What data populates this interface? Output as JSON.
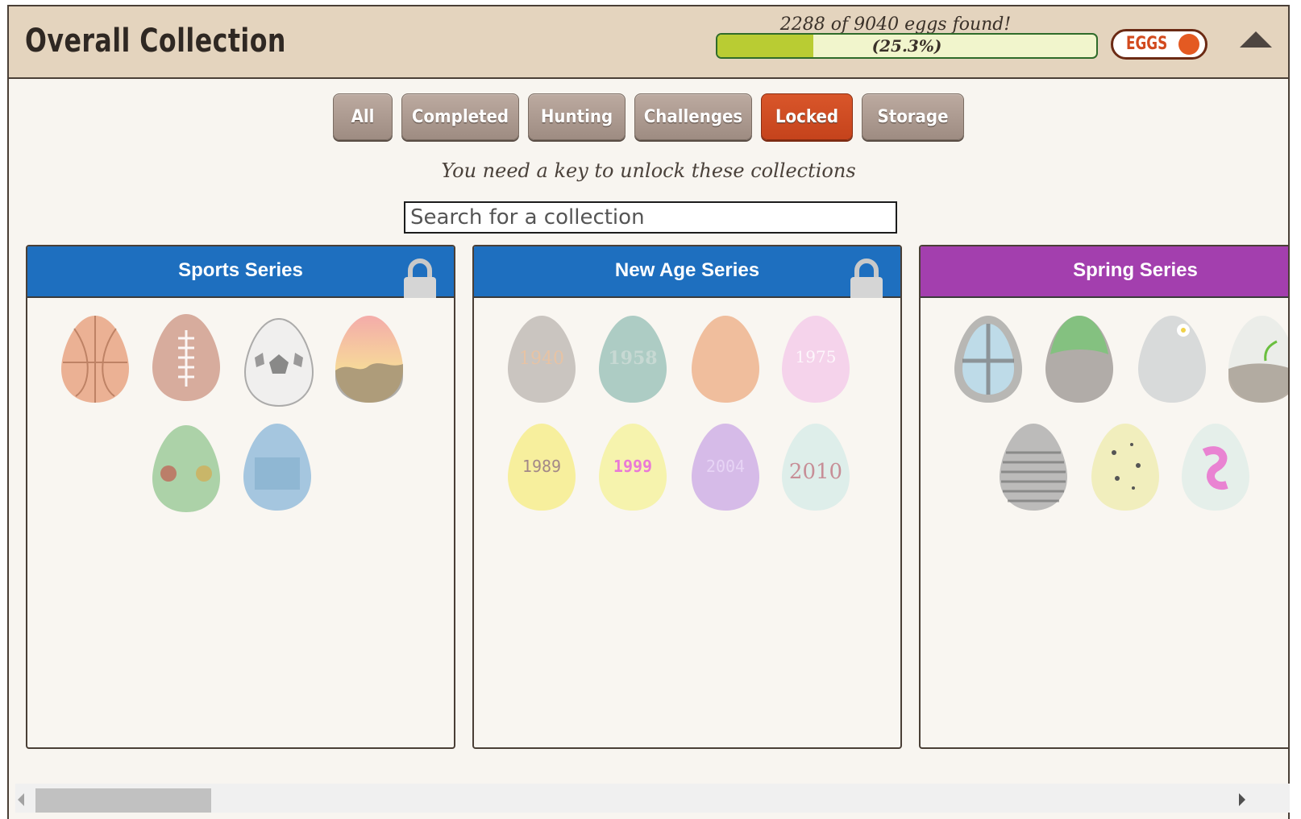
{
  "header": {
    "title": "Overall Collection",
    "progress_text": "2288 of 9040 eggs found!",
    "progress_pct": "(25.3%)",
    "progress_fraction": 0.253,
    "toggle_label": "EGGS",
    "collapse_icon": "triangle-up-icon"
  },
  "filters": [
    {
      "label": "All",
      "active": false
    },
    {
      "label": "Completed",
      "active": false
    },
    {
      "label": "Hunting",
      "active": false
    },
    {
      "label": "Challenges",
      "active": false
    },
    {
      "label": "Locked",
      "active": true
    },
    {
      "label": "Storage",
      "active": false
    }
  ],
  "hint": "You need a key to unlock these collections",
  "search": {
    "placeholder": "Search for a collection"
  },
  "collections": [
    {
      "name": "Sports Series",
      "color": "#1e6fbf",
      "locked": true,
      "eggs": [
        "basketball-egg",
        "football-egg",
        "soccer-ball-egg",
        "sunset-egg",
        "football-field-egg",
        "touchdown-egg"
      ],
      "egg_labels": [
        "",
        "",
        "",
        "",
        "",
        ""
      ]
    },
    {
      "name": "New Age Series",
      "color": "#1e6fbf",
      "locked": true,
      "eggs": [
        "egg-1940",
        "egg-1958",
        "egg-orange",
        "egg-1975",
        "egg-1989",
        "egg-1999",
        "egg-2004",
        "egg-2010"
      ],
      "egg_labels": [
        "1940",
        "1958",
        "",
        "1975",
        "1989",
        "1999",
        "2004",
        "2010"
      ]
    },
    {
      "name": "Spring Series",
      "color": "#a33fae",
      "locked": false,
      "eggs": [
        "window-egg",
        "grass-egg",
        "flower-egg",
        "sprout-egg",
        "striped-egg",
        "speckled-egg",
        "pink-swirl-egg"
      ],
      "egg_labels": [
        "",
        "",
        "",
        "",
        "",
        "",
        ""
      ]
    }
  ],
  "colors": {
    "accent": "#c5431c",
    "progress_fill": "#b9cc33",
    "header_bg": "#e4d4be"
  }
}
